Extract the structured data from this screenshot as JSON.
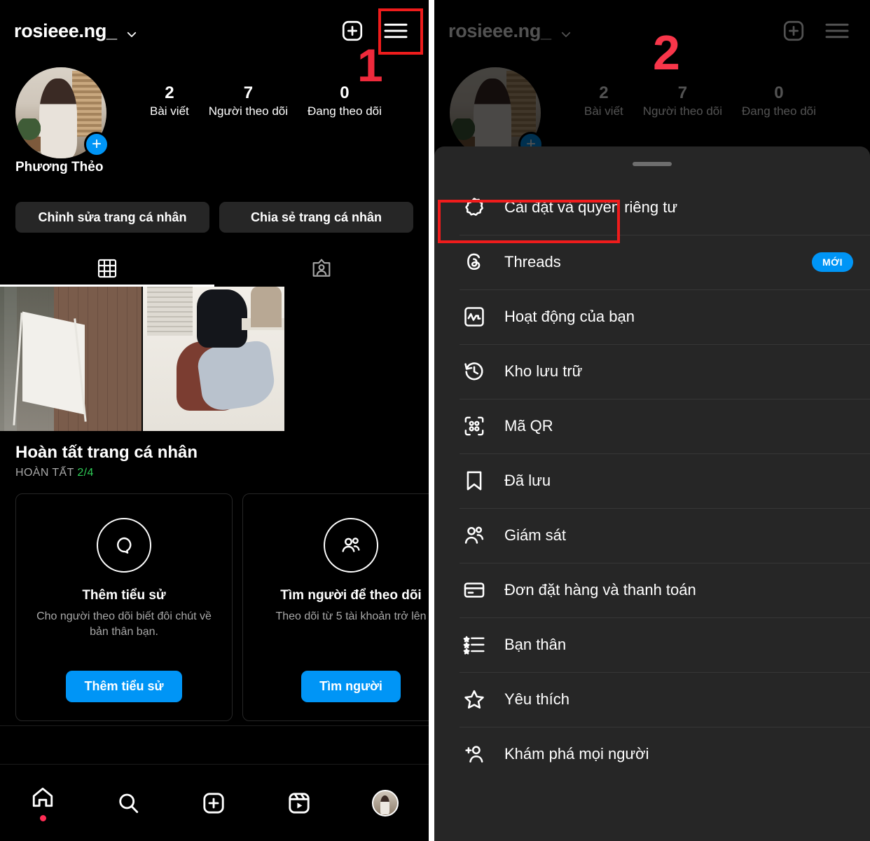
{
  "left": {
    "header": {
      "username": "rosieee.ng_",
      "chevron_icon": "chevron-down-icon",
      "add_icon": "plus-box-icon",
      "menu_icon": "hamburger-menu-icon"
    },
    "profile": {
      "full_name": "Phương Thẻo",
      "avatar_plus_label": "+",
      "stats": [
        {
          "num": "2",
          "label": "Bài viết"
        },
        {
          "num": "7",
          "label": "Người theo dõi"
        },
        {
          "num": "0",
          "label": "Đang theo dõi"
        }
      ]
    },
    "actions": [
      {
        "label": "Chỉnh sửa trang cá nhân"
      },
      {
        "label": "Chia sẻ trang cá nhân"
      }
    ],
    "tabs": [
      {
        "name": "grid-tab",
        "icon": "grid-icon",
        "active": true
      },
      {
        "name": "tagged-tab",
        "icon": "tagged-person-icon",
        "active": false
      }
    ],
    "complete_profile": {
      "title": "Hoàn tất trang cá nhân",
      "progress_label": "HOÀN TẤT",
      "progress_value": "2/4",
      "cards": [
        {
          "icon": "bio-bubble-icon",
          "title": "Thêm tiểu sử",
          "desc": "Cho người theo dõi biết đôi chút về bản thân bạn.",
          "button": "Thêm tiểu sử"
        },
        {
          "icon": "people-icon",
          "title": "Tìm người để theo dõi",
          "desc": "Theo dõi từ 5 tài khoản trở lên",
          "button": "Tìm người"
        }
      ]
    },
    "bottom_nav": [
      {
        "name": "home",
        "icon": "home-icon",
        "has_dot": true
      },
      {
        "name": "search",
        "icon": "search-icon",
        "has_dot": false
      },
      {
        "name": "create",
        "icon": "plus-box-icon",
        "has_dot": false
      },
      {
        "name": "reels",
        "icon": "reels-icon",
        "has_dot": false
      },
      {
        "name": "profile",
        "icon": "profile-avatar-icon",
        "has_dot": false
      }
    ]
  },
  "right": {
    "header": {
      "username": "rosieee.ng_",
      "stats": [
        {
          "num": "2",
          "label": "Bài viết"
        },
        {
          "num": "7",
          "label": "Người theo dõi"
        },
        {
          "num": "0",
          "label": "Đang theo dõi"
        }
      ]
    },
    "sheet": {
      "handle": "drag-handle",
      "items": [
        {
          "icon": "gear-settings-icon",
          "label": "Cài đặt và quyền riêng tư",
          "badge": ""
        },
        {
          "icon": "threads-icon",
          "label": "Threads",
          "badge": "MỚI"
        },
        {
          "icon": "activity-chart-icon",
          "label": "Hoạt động của bạn",
          "badge": ""
        },
        {
          "icon": "archive-clock-icon",
          "label": "Kho lưu trữ",
          "badge": ""
        },
        {
          "icon": "qr-code-icon",
          "label": "Mã QR",
          "badge": ""
        },
        {
          "icon": "bookmark-icon",
          "label": "Đã lưu",
          "badge": ""
        },
        {
          "icon": "supervision-people-icon",
          "label": "Giám sát",
          "badge": ""
        },
        {
          "icon": "credit-card-icon",
          "label": "Đơn đặt hàng và thanh toán",
          "badge": ""
        },
        {
          "icon": "close-friends-list-icon",
          "label": "Bạn thân",
          "badge": ""
        },
        {
          "icon": "star-icon",
          "label": "Yêu thích",
          "badge": ""
        },
        {
          "icon": "add-person-icon",
          "label": "Khám phá mọi người",
          "badge": ""
        }
      ]
    }
  },
  "annotations": {
    "step1": "1",
    "step2": "2",
    "highlight_color": "#ef1c1c"
  }
}
